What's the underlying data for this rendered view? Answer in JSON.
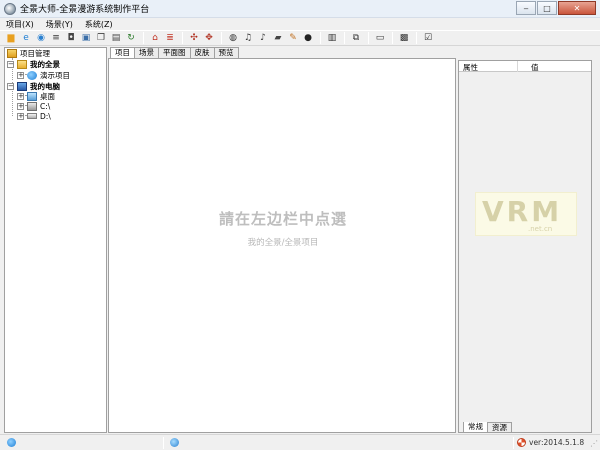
{
  "window": {
    "title": "全景大师-全景漫游系统制作平台",
    "btn_min": "‒",
    "btn_max": "□",
    "btn_close": "✕"
  },
  "menu": [
    "项目(X)",
    "场景(Y)",
    "系统(Z)"
  ],
  "toolbar": [
    {
      "icon": "folder-open-icon",
      "glyph": "▆",
      "color": "#e8a020"
    },
    {
      "icon": "ie-icon",
      "glyph": "e",
      "color": "#1e7ed4"
    },
    {
      "icon": "globe-icon",
      "glyph": "◉",
      "color": "#2a80d0"
    },
    {
      "icon": "list-icon",
      "glyph": "≡",
      "color": "#333333"
    },
    {
      "icon": "camera-icon",
      "glyph": "◘",
      "color": "#444444"
    },
    {
      "icon": "image-icon",
      "glyph": "▣",
      "color": "#3a6ea8"
    },
    {
      "icon": "copy-icon",
      "glyph": "❐",
      "color": "#444444"
    },
    {
      "icon": "paste-icon",
      "glyph": "▤",
      "color": "#444444"
    },
    {
      "icon": "refresh-icon",
      "glyph": "↻",
      "color": "#2a7a2a"
    },
    {
      "sep": true
    },
    {
      "icon": "home-icon",
      "glyph": "⌂",
      "color": "#c03020"
    },
    {
      "icon": "menu-icon",
      "glyph": "≣",
      "color": "#c03020"
    },
    {
      "sep": true
    },
    {
      "icon": "hotspot-move-icon",
      "glyph": "✣",
      "color": "#b03020"
    },
    {
      "icon": "hotspot-arrow-icon",
      "glyph": "✥",
      "color": "#b03020"
    },
    {
      "sep": true
    },
    {
      "icon": "sound-icon",
      "glyph": "◍",
      "color": "#333333"
    },
    {
      "icon": "music-icon",
      "glyph": "♫",
      "color": "#333333"
    },
    {
      "icon": "music-note-icon",
      "glyph": "♪",
      "color": "#333333"
    },
    {
      "icon": "hat-icon",
      "glyph": "▰",
      "color": "#444444"
    },
    {
      "icon": "edit-icon",
      "glyph": "✎",
      "color": "#c07020"
    },
    {
      "icon": "circle-icon",
      "glyph": "●",
      "color": "#222222"
    },
    {
      "sep": true
    },
    {
      "icon": "film-icon",
      "glyph": "▥",
      "color": "#333333"
    },
    {
      "sep": true
    },
    {
      "icon": "layers-icon",
      "glyph": "⧉",
      "color": "#333333"
    },
    {
      "sep": true
    },
    {
      "icon": "video-icon",
      "glyph": "▭",
      "color": "#333333"
    },
    {
      "sep": true
    },
    {
      "icon": "vr-icon",
      "glyph": "▩",
      "color": "#333333"
    },
    {
      "sep": true
    },
    {
      "icon": "checklist-icon",
      "glyph": "☑",
      "color": "#333333"
    }
  ],
  "tree": {
    "root": "项目管理",
    "my_panorama": "我的全景",
    "demo_project": "演示项目",
    "my_computer": "我的电脑",
    "desktop": "桌面",
    "drive_c": "C:\\",
    "drive_d": "D:\\",
    "expand_plus": "+",
    "expand_minus": "−"
  },
  "center": {
    "tabs": [
      "项目",
      "场景",
      "平面图",
      "皮肤",
      "预览"
    ],
    "hint_main": "請在左边栏中点選",
    "hint_sub": "我的全景/全景项目"
  },
  "properties": {
    "col_property": "属性",
    "col_value": "值",
    "tabs": [
      "常规",
      "资源"
    ],
    "watermark_main": "VRM",
    "watermark_sub": ".net.cn"
  },
  "status": {
    "version": "ver:2014.5.1.8"
  },
  "colors": {
    "accent": "#1e7ed4",
    "folder": "#e8b030",
    "hint": "#bebebe"
  }
}
